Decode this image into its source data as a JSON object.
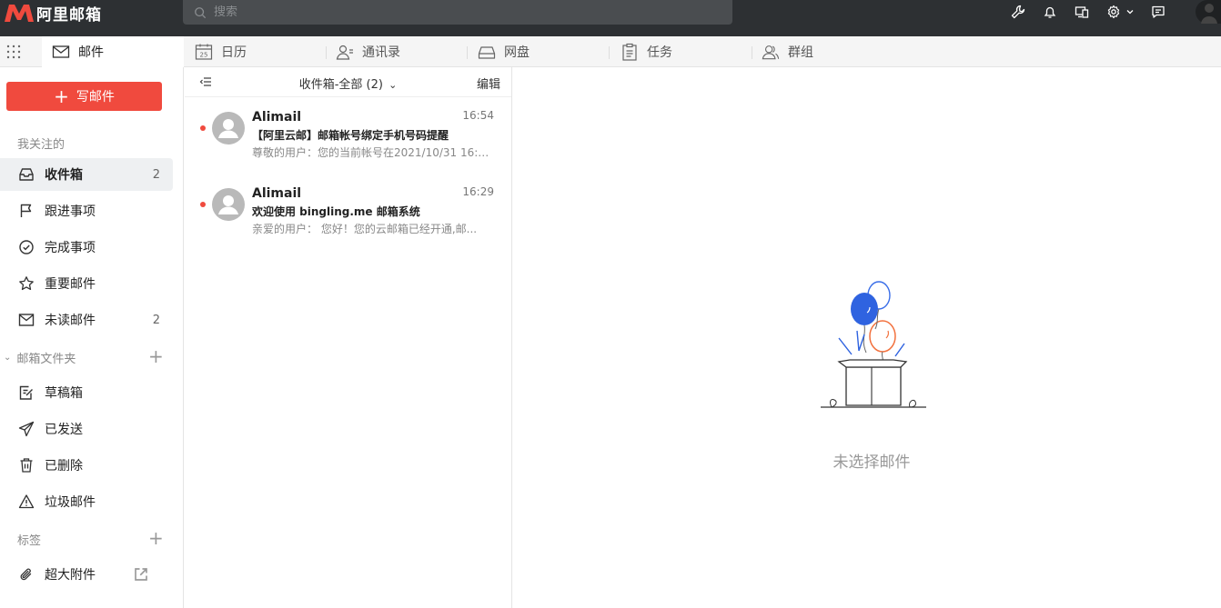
{
  "app": {
    "logo_text": "阿里邮箱",
    "accent": "#f04a3e"
  },
  "search": {
    "placeholder": "搜索"
  },
  "top_icons": [
    "wrench-icon",
    "bell-icon",
    "devices-icon",
    "gear-icon",
    "chevron-down-icon",
    "chat-icon"
  ],
  "nav": {
    "tabs": [
      {
        "label": "邮件",
        "icon": "mail-icon"
      },
      {
        "label": "日历",
        "icon": "calendar-icon",
        "badge": "25"
      },
      {
        "label": "通讯录",
        "icon": "contacts-icon"
      },
      {
        "label": "网盘",
        "icon": "disk-icon"
      },
      {
        "label": "任务",
        "icon": "clipboard-icon"
      },
      {
        "label": "群组",
        "icon": "group-icon"
      }
    ]
  },
  "sidebar": {
    "compose_label": "写邮件",
    "followed_head": "我关注的",
    "items": [
      {
        "label": "收件箱",
        "count": "2"
      },
      {
        "label": "跟进事项"
      },
      {
        "label": "完成事项"
      },
      {
        "label": "重要邮件"
      },
      {
        "label": "未读邮件",
        "count": "2"
      }
    ],
    "folders_head": "邮箱文件夹",
    "folders": [
      {
        "label": "草稿箱"
      },
      {
        "label": "已发送"
      },
      {
        "label": "已删除"
      },
      {
        "label": "垃圾邮件"
      }
    ],
    "tags_head": "标签",
    "attachments_label": "超大附件"
  },
  "maillist": {
    "title": "收件箱-全部 (2)",
    "edit_label": "编辑",
    "mails": [
      {
        "sender": "Alimail",
        "time": "16:54",
        "subject": "【阿里云邮】邮箱帐号绑定手机号码提醒",
        "preview": "尊敬的用户：您的当前帐号在2021/10/31 16:5..."
      },
      {
        "sender": "Alimail",
        "time": "16:29",
        "subject": "欢迎使用 bingling.me 邮箱系统",
        "preview": "亲爱的用户：   您好！您的云邮箱已经开通,邮..."
      }
    ]
  },
  "reading": {
    "empty_text": "未选择邮件"
  }
}
